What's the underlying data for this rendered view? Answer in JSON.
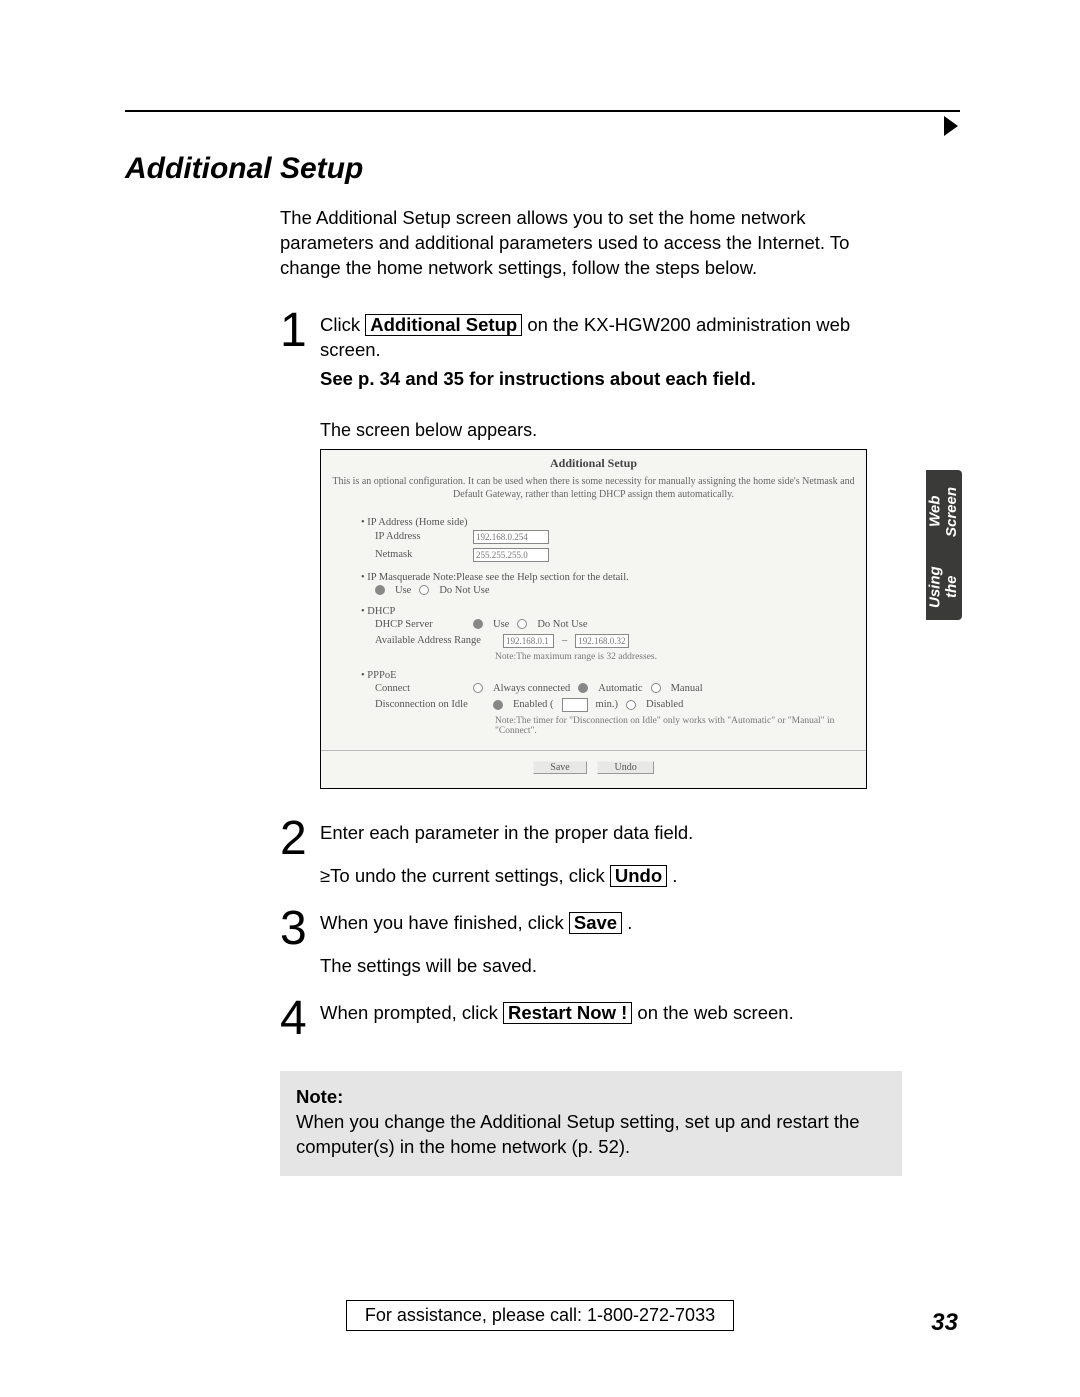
{
  "arrow": "▶",
  "rule": "",
  "title": "Additional Setup",
  "intro": "The Additional Setup screen allows you to set the home network parameters and additional parameters used to access the Internet. To change the home network settings, follow the steps below.",
  "sideTab": {
    "line1": "Using the",
    "line2": "Web Screen"
  },
  "steps": {
    "s1": {
      "num": "1",
      "pre": "Click ",
      "btn": "Additional Setup",
      "post": " on the KX-HGW200 administration web screen.",
      "see": "See p. 34 and 35 for instructions about each field.",
      "caption": "The screen below appears."
    },
    "s2": {
      "num": "2",
      "line": "Enter each parameter in the proper data field.",
      "bullet": "≥To undo the current settings, click ",
      "btn": "Undo",
      "post": " ."
    },
    "s3": {
      "num": "3",
      "line": "When you have finished, click ",
      "btn": "Save",
      "post": " .",
      "after": "The settings will be saved."
    },
    "s4": {
      "num": "4",
      "line": "When prompted, click ",
      "btn": "Restart Now !",
      "post": " on the web screen."
    }
  },
  "innerScreen": {
    "title": "Additional Setup",
    "desc": "This is an optional configuration. It can be used when there is some necessity for manually assigning the home side's Netmask and Default Gateway, rather than letting DHCP assign them automatically.",
    "ipaddr_head": "• IP Address (Home side)",
    "ipaddr_lab": "IP Address",
    "ipaddr_val": "192.168.0.254",
    "netmask_lab": "Netmask",
    "netmask_val": "255.255.255.0",
    "masq_head": "• IP Masquerade Note:Please see the Help section for the detail.",
    "masq_use": "Use",
    "masq_notuse": "Do Not Use",
    "dhcp_head": "• DHCP",
    "dhcp_server": "DHCP Server",
    "dhcp_use": "Use",
    "dhcp_notuse": "Do Not Use",
    "range_lab": "Available Address Range",
    "range_from": "192.168.0.1",
    "range_to": "192.168.0.32",
    "range_note": "Note:The maximum range is 32 addresses.",
    "pppoe_head": "• PPPoE",
    "connect_lab": "Connect",
    "connect_always": "Always connected",
    "connect_auto": "Automatic",
    "connect_manual": "Manual",
    "disc_lab": "Disconnection on Idle",
    "disc_enabled": "Enabled (",
    "disc_min": " min.)",
    "disc_disabled": "Disabled",
    "disc_note": "Note:The timer for \"Disconnection on Idle\" only works with \"Automatic\" or \"Manual\" in \"Connect\".",
    "save": "Save",
    "undo": "Undo"
  },
  "note": {
    "label": "Note:",
    "body": "When you change the Additional Setup setting, set up and restart the computer(s) in the home network (p. 52)."
  },
  "footer": {
    "assist": "For assistance, please call: 1-800-272-7033",
    "page": "33"
  }
}
